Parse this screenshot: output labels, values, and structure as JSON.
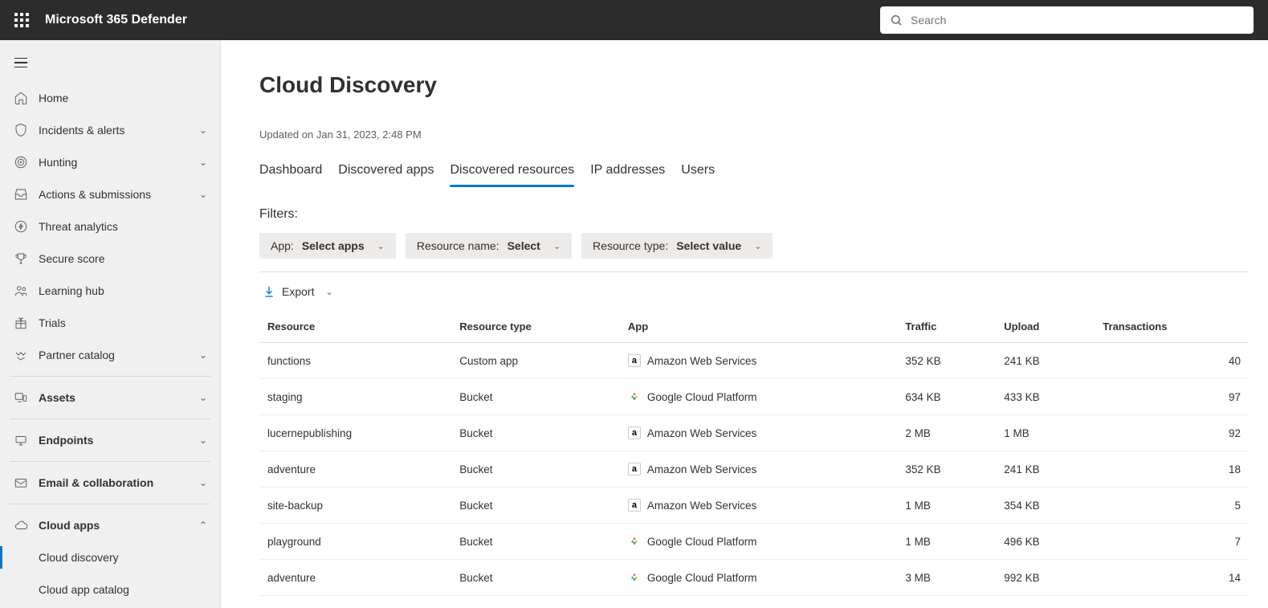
{
  "header": {
    "product_name": "Microsoft 365 Defender",
    "search_placeholder": "Search"
  },
  "sidebar": {
    "items": [
      {
        "key": "home",
        "label": "Home",
        "icon": "home",
        "bold": false,
        "expandable": false
      },
      {
        "key": "incidents",
        "label": "Incidents & alerts",
        "icon": "shield",
        "bold": false,
        "expandable": true
      },
      {
        "key": "hunting",
        "label": "Hunting",
        "icon": "target",
        "bold": false,
        "expandable": true
      },
      {
        "key": "actions",
        "label": "Actions & submissions",
        "icon": "inbox",
        "bold": false,
        "expandable": true
      },
      {
        "key": "threat",
        "label": "Threat analytics",
        "icon": "lightning",
        "bold": false,
        "expandable": false
      },
      {
        "key": "secure",
        "label": "Secure score",
        "icon": "trophy",
        "bold": false,
        "expandable": false
      },
      {
        "key": "learning",
        "label": "Learning hub",
        "icon": "people",
        "bold": false,
        "expandable": false
      },
      {
        "key": "trials",
        "label": "Trials",
        "icon": "gift",
        "bold": false,
        "expandable": false
      },
      {
        "key": "partner",
        "label": "Partner catalog",
        "icon": "handshake",
        "bold": false,
        "expandable": true
      },
      {
        "divider": true
      },
      {
        "key": "assets",
        "label": "Assets",
        "icon": "devices",
        "bold": true,
        "expandable": true
      },
      {
        "divider": true
      },
      {
        "key": "endpoints",
        "label": "Endpoints",
        "icon": "endpoints",
        "bold": true,
        "expandable": true
      },
      {
        "divider": true
      },
      {
        "key": "email",
        "label": "Email & collaboration",
        "icon": "mail",
        "bold": true,
        "expandable": true
      },
      {
        "divider": true
      },
      {
        "key": "cloudapps",
        "label": "Cloud apps",
        "icon": "cloud",
        "bold": true,
        "expandable": true,
        "expanded": true,
        "children": [
          {
            "key": "clouddiscovery",
            "label": "Cloud discovery",
            "active": true
          },
          {
            "key": "cloudappcatalog",
            "label": "Cloud app catalog",
            "active": false
          }
        ]
      }
    ]
  },
  "main": {
    "title": "Cloud Discovery",
    "updated_prefix": "Updated on ",
    "updated_value": "Jan 31, 2023, 2:48 PM",
    "tabs": [
      {
        "label": "Dashboard",
        "selected": false
      },
      {
        "label": "Discovered apps",
        "selected": false
      },
      {
        "label": "Discovered resources",
        "selected": true
      },
      {
        "label": "IP addresses",
        "selected": false
      },
      {
        "label": "Users",
        "selected": false
      }
    ],
    "filters_label": "Filters:",
    "filters": [
      {
        "prefix": "App: ",
        "value": "Select apps"
      },
      {
        "prefix": "Resource name: ",
        "value": "Select"
      },
      {
        "prefix": "Resource type: ",
        "value": "Select value"
      }
    ],
    "export_label": "Export",
    "columns": [
      "Resource",
      "Resource type",
      "App",
      "Traffic",
      "Upload",
      "Transactions"
    ],
    "rows": [
      {
        "resource": "functions",
        "resource_type": "Custom app",
        "app": "Amazon Web Services",
        "app_icon": "aws",
        "traffic": "352 KB",
        "upload": "241 KB",
        "transactions": "40"
      },
      {
        "resource": "staging",
        "resource_type": "Bucket",
        "app": "Google Cloud Platform",
        "app_icon": "gcp",
        "traffic": "634 KB",
        "upload": "433 KB",
        "transactions": "97"
      },
      {
        "resource": "lucernepublishing",
        "resource_type": "Bucket",
        "app": "Amazon Web Services",
        "app_icon": "aws",
        "traffic": "2 MB",
        "upload": "1 MB",
        "transactions": "92"
      },
      {
        "resource": "adventure",
        "resource_type": "Bucket",
        "app": "Amazon Web Services",
        "app_icon": "aws",
        "traffic": "352 KB",
        "upload": "241 KB",
        "transactions": "18"
      },
      {
        "resource": "site-backup",
        "resource_type": "Bucket",
        "app": "Amazon Web Services",
        "app_icon": "aws",
        "traffic": "1 MB",
        "upload": "354 KB",
        "transactions": "5"
      },
      {
        "resource": "playground",
        "resource_type": "Bucket",
        "app": "Google Cloud Platform",
        "app_icon": "gcp",
        "traffic": "1 MB",
        "upload": "496 KB",
        "transactions": "7"
      },
      {
        "resource": "adventure",
        "resource_type": "Bucket",
        "app": "Google Cloud Platform",
        "app_icon": "gcp",
        "traffic": "3 MB",
        "upload": "992 KB",
        "transactions": "14"
      }
    ]
  }
}
